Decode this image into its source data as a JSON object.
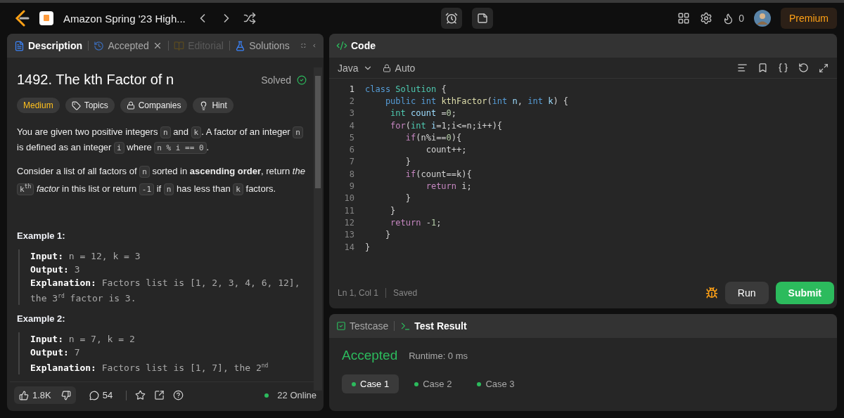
{
  "nav": {
    "list_title": "Amazon Spring '23 High...",
    "streak": "0",
    "premium": "Premium"
  },
  "left_tabs": [
    {
      "label": "Description",
      "kind": "description",
      "selected": true,
      "disabled": false
    },
    {
      "label": "Accepted",
      "kind": "accepted",
      "selected": false,
      "disabled": false,
      "closable": true
    },
    {
      "label": "Editorial",
      "kind": "editorial",
      "selected": false,
      "disabled": true
    },
    {
      "label": "Solutions",
      "kind": "solutions",
      "selected": false,
      "disabled": false
    }
  ],
  "problem": {
    "title": "1492. The kth Factor of n",
    "status": "Solved",
    "solved": true,
    "tags": [
      {
        "label": "Medium",
        "kind": "difficulty"
      },
      {
        "label": "Topics",
        "kind": "topics"
      },
      {
        "label": "Companies",
        "kind": "companies"
      },
      {
        "label": "Hint",
        "kind": "hint"
      }
    ],
    "paragraphs": [
      [
        {
          "kind": "text",
          "text": "You are given two positive integers"
        },
        {
          "kind": "code",
          "text": "n"
        },
        {
          "kind": "text",
          "text": "and"
        },
        {
          "kind": "code",
          "text": "k"
        },
        {
          "kind": "text",
          "text": ". A factor of an integer"
        },
        {
          "kind": "code",
          "text": "n"
        },
        {
          "kind": "text",
          "text": "is defined as an integer"
        },
        {
          "kind": "code",
          "text": "i"
        },
        {
          "kind": "text",
          "text": "where"
        },
        {
          "kind": "code",
          "text": "n % i == 0"
        },
        {
          "kind": "text",
          "text": "."
        }
      ],
      [
        {
          "kind": "text",
          "text": "Consider a list of all factors of"
        },
        {
          "kind": "code",
          "text": "n"
        },
        {
          "kind": "text",
          "text": "sorted in **ascending order**, return"
        },
        {
          "kind": "italic",
          "text": "the"
        },
        {
          "kind": "code",
          "text": "k$^{th}$"
        },
        {
          "kind": "italic",
          "text": "factor"
        },
        {
          "kind": "text",
          "text": "in this list or return"
        },
        {
          "kind": "code",
          "text": "-1"
        },
        {
          "kind": "text",
          "text": "if"
        },
        {
          "kind": "code",
          "text": "n"
        },
        {
          "kind": "text",
          "text": "has less than"
        },
        {
          "kind": "code",
          "text": "k"
        },
        {
          "kind": "text",
          "text": "factors."
        }
      ]
    ],
    "examples": [
      {
        "title": "Example 1:",
        "lines": [
          {
            "label": "Input:",
            "value": "n = 12, k = 3"
          },
          {
            "label": "Output:",
            "value": "3"
          },
          {
            "label": "Explanation:",
            "value": "Factors list is [1, 2, 3, 4, 6, 12], the 3$^{rd}$ factor is 3."
          }
        ]
      },
      {
        "title": "Example 2:",
        "lines": [
          {
            "label": "Input:",
            "value": "n = 7, k = 2"
          },
          {
            "label": "Output:",
            "value": "7"
          },
          {
            "label": "Explanation:",
            "value": "Factors list is [1, 7], the 2$^{nd}$"
          }
        ]
      }
    ]
  },
  "footer": {
    "likes": "1.8K",
    "comments": "54",
    "online": "22 Online"
  },
  "code_panel": {
    "title": "Code",
    "language": "Java",
    "mode": "Auto",
    "cursor": "Ln 1, Col 1",
    "save_state": "Saved",
    "run": "Run",
    "submit": "Submit",
    "lines": [
      {
        "number": "1",
        "tokens": [
          {
            "kind": "kw",
            "text": "class "
          },
          {
            "kind": "type",
            "text": "Solution"
          },
          {
            "kind": "plain",
            "text": " {"
          }
        ]
      },
      {
        "number": "2",
        "tokens": [
          {
            "kind": "kw",
            "text": "    public int "
          },
          {
            "kind": "fn",
            "text": "kthFactor"
          },
          {
            "kind": "plain",
            "text": "("
          },
          {
            "kind": "kw",
            "text": "int "
          },
          {
            "kind": "var",
            "text": "n"
          },
          {
            "kind": "plain",
            "text": ", "
          },
          {
            "kind": "kw",
            "text": "int "
          },
          {
            "kind": "var",
            "text": "k"
          },
          {
            "kind": "plain",
            "text": ") {"
          }
        ]
      },
      {
        "number": "3",
        "tokens": [
          {
            "kind": "type",
            "text": "     int "
          },
          {
            "kind": "var",
            "text": "count"
          },
          {
            "kind": "plain",
            "text": " ="
          },
          {
            "kind": "num",
            "text": "0"
          },
          {
            "kind": "plain",
            "text": ";"
          }
        ]
      },
      {
        "number": "4",
        "tokens": [
          {
            "kind": "ctrl",
            "text": "     for"
          },
          {
            "kind": "plain",
            "text": "("
          },
          {
            "kind": "type",
            "text": "int "
          },
          {
            "kind": "var",
            "text": "i"
          },
          {
            "kind": "plain",
            "text": "=1;i<=n;i++){"
          }
        ]
      },
      {
        "number": "5",
        "tokens": [
          {
            "kind": "ctrl",
            "text": "        if"
          },
          {
            "kind": "plain",
            "text": "(n%i=="
          },
          {
            "kind": "num",
            "text": "0"
          },
          {
            "kind": "plain",
            "text": "){"
          }
        ]
      },
      {
        "number": "6",
        "tokens": [
          {
            "kind": "plain",
            "text": "            count++;"
          }
        ]
      },
      {
        "number": "7",
        "tokens": [
          {
            "kind": "plain",
            "text": "        }"
          }
        ]
      },
      {
        "number": "8",
        "tokens": [
          {
            "kind": "ctrl",
            "text": "        if"
          },
          {
            "kind": "plain",
            "text": "(count==k){"
          }
        ]
      },
      {
        "number": "9",
        "tokens": [
          {
            "kind": "ctrl",
            "text": "            return"
          },
          {
            "kind": "plain",
            "text": " i;"
          }
        ]
      },
      {
        "number": "10",
        "tokens": [
          {
            "kind": "plain",
            "text": "        }"
          }
        ]
      },
      {
        "number": "11",
        "tokens": [
          {
            "kind": "plain",
            "text": "     }"
          }
        ]
      },
      {
        "number": "12",
        "tokens": [
          {
            "kind": "ctrl",
            "text": "     return"
          },
          {
            "kind": "plain",
            "text": " -"
          },
          {
            "kind": "num",
            "text": "1"
          },
          {
            "kind": "plain",
            "text": ";"
          }
        ]
      },
      {
        "number": "13",
        "tokens": [
          {
            "kind": "plain",
            "text": "    }"
          }
        ]
      },
      {
        "number": "14",
        "tokens": [
          {
            "kind": "plain",
            "text": "}"
          }
        ]
      }
    ]
  },
  "result_tabs": [
    {
      "label": "Testcase",
      "kind": "testcase",
      "selected": false
    },
    {
      "label": "Test Result",
      "kind": "result",
      "selected": true
    }
  ],
  "result": {
    "verdict": "Accepted",
    "runtime": "Runtime: 0 ms",
    "cases": [
      {
        "label": "Case 1",
        "selected": true,
        "color": "#2cbb5d"
      },
      {
        "label": "Case 2",
        "selected": false,
        "color": "#2cbb5d"
      },
      {
        "label": "Case 3",
        "selected": false,
        "color": "#2cbb5d"
      }
    ]
  }
}
